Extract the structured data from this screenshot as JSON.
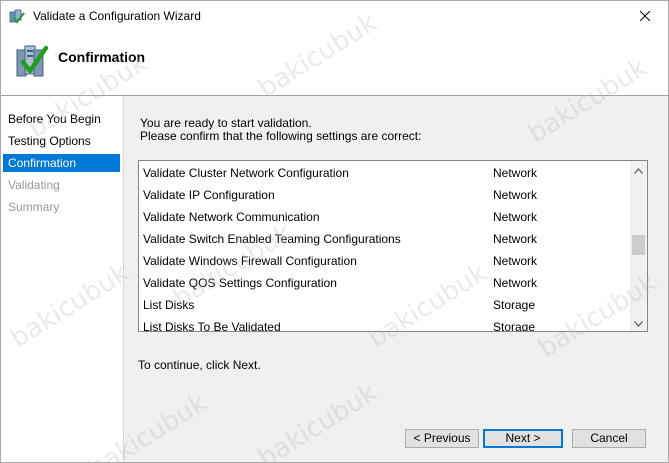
{
  "window": {
    "title": "Validate a Configuration Wizard",
    "close_icon": "close-icon",
    "app_icon": "cluster-validate-icon"
  },
  "header": {
    "title": "Confirmation",
    "icon": "validation-checklist-icon"
  },
  "nav": {
    "items": [
      {
        "label": "Before You Begin",
        "state": "normal"
      },
      {
        "label": "Testing Options",
        "state": "normal"
      },
      {
        "label": "Confirmation",
        "state": "active"
      },
      {
        "label": "Validating",
        "state": "disabled"
      },
      {
        "label": "Summary",
        "state": "disabled"
      }
    ]
  },
  "main": {
    "intro_line1": "You are ready to start validation.",
    "intro_line2": "Please confirm that the following settings are correct:",
    "tests": [
      {
        "name": "Validate Cluster Network Configuration",
        "category": "Network"
      },
      {
        "name": "Validate IP Configuration",
        "category": "Network"
      },
      {
        "name": "Validate Network Communication",
        "category": "Network"
      },
      {
        "name": "Validate Switch Enabled Teaming Configurations",
        "category": "Network"
      },
      {
        "name": "Validate Windows Firewall Configuration",
        "category": "Network"
      },
      {
        "name": "Validate QOS Settings Configuration",
        "category": "Network"
      },
      {
        "name": "List Disks",
        "category": "Storage"
      },
      {
        "name": "List Disks To Be Validated",
        "category": "Storage"
      }
    ],
    "continue_text": "To continue, click Next."
  },
  "buttons": {
    "previous": "< Previous",
    "next": "Next >",
    "cancel": "Cancel"
  },
  "watermark": "bakicubuk",
  "colors": {
    "accent": "#0078d7",
    "panel_bg": "#f0f0f0",
    "disabled_text": "#9a9a9a"
  }
}
